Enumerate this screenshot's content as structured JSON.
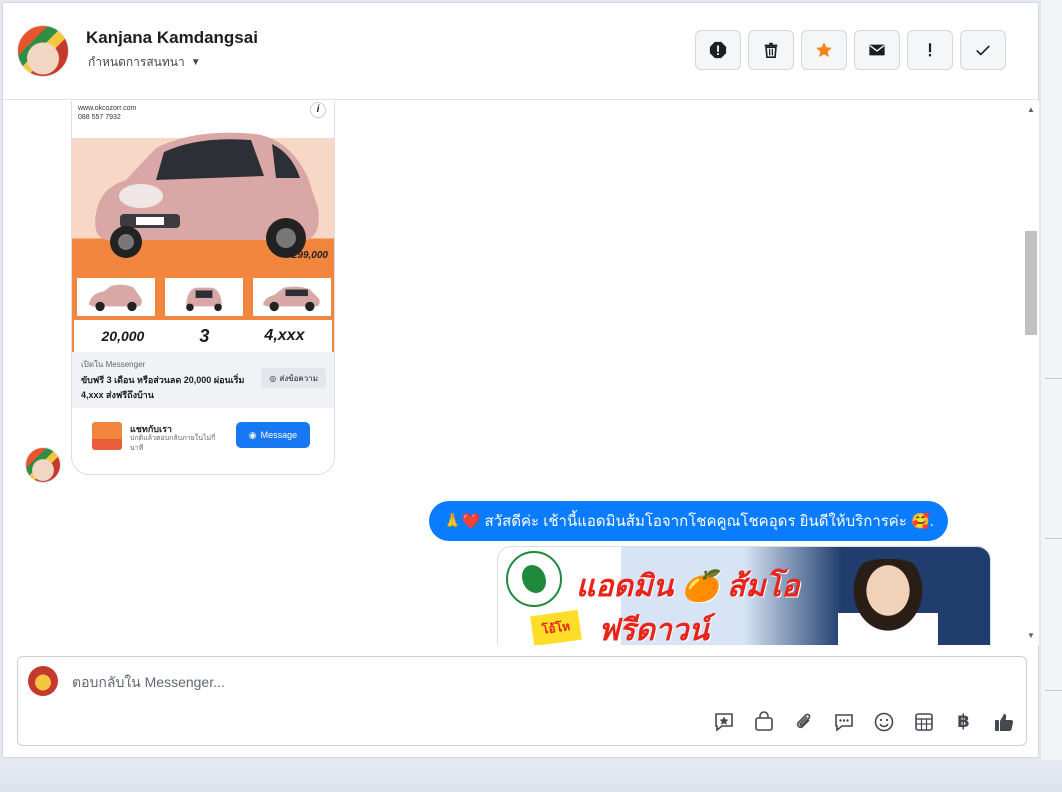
{
  "header": {
    "contact_name": "Kanjana Kamdangsai",
    "assign_label": "กำหนดการสนทนา"
  },
  "actions": [
    {
      "name": "mark-spam-button",
      "icon": "alert-octagon-icon"
    },
    {
      "name": "delete-button",
      "icon": "trash-icon"
    },
    {
      "name": "star-button",
      "icon": "star-icon",
      "color": "#f5831f"
    },
    {
      "name": "mark-unread-button",
      "icon": "envelope-icon"
    },
    {
      "name": "follow-up-button",
      "icon": "exclamation-icon"
    },
    {
      "name": "mark-done-button",
      "icon": "check-icon"
    }
  ],
  "ad": {
    "price": "299,000",
    "promo_down": "20,000",
    "promo_months": "3",
    "promo_installment": "4,xxx",
    "open_in": "เปิดใน Messenger",
    "description": "ขับฟรี 3 เดือน หรือส่วนลด 20,000 ผ่อนเริ่ม 4,xxx ส่งฟรีถึงบ้าน",
    "send_label": "ส่งข้อความ",
    "chat_title": "แชทกับเรา",
    "chat_sub": "ปกติแล้วตอบกลับภายในไม่กี่นาที",
    "message_button": "Message"
  },
  "outgoing": {
    "text": "🙏❤️ สวัสดีค่ะ เช้านี้แอดมินส้มโอจากโชคคูณโชคอุดร ยินดีให้บริการค่ะ 🥰."
  },
  "banner": {
    "line1": "แอดมิน 🍊 ส้มโอ",
    "line2": "ฟรีดาวน์",
    "burst": "โอ้โห"
  },
  "composer": {
    "placeholder": "ตอบกลับใน Messenger..."
  },
  "tools": [
    {
      "name": "saved-reply-icon"
    },
    {
      "name": "shop-bag-icon"
    },
    {
      "name": "attachment-icon"
    },
    {
      "name": "chat-bubble-icon"
    },
    {
      "name": "emoji-icon"
    },
    {
      "name": "appointment-icon"
    },
    {
      "name": "baht-payment-icon",
      "glyph": "฿"
    },
    {
      "name": "like-icon"
    }
  ],
  "colors": {
    "accent": "#0a7cff",
    "messenger_blue": "#1877f2",
    "star_orange": "#f5831f"
  }
}
